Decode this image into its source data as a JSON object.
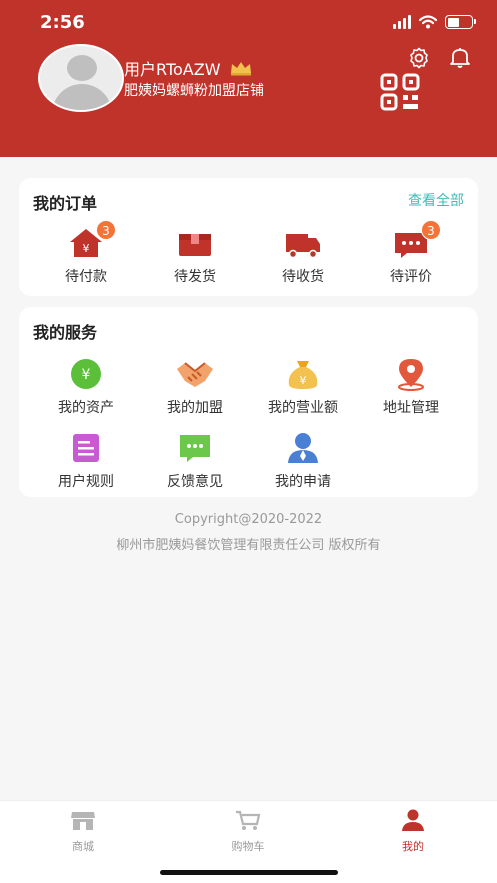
{
  "status_bar": {
    "time": "2:56"
  },
  "profile": {
    "username": "用户RToAZW",
    "store_name": "肥姨妈螺蛳粉加盟店铺"
  },
  "orders": {
    "title": "我的订单",
    "view_all": "查看全部",
    "items": [
      {
        "label": "待付款",
        "badge": "3",
        "icon": "pending-payment-icon",
        "color": "#c0332a"
      },
      {
        "label": "待发货",
        "badge": "",
        "icon": "pending-shipment-icon",
        "color": "#c0332a"
      },
      {
        "label": "待收货",
        "badge": "",
        "icon": "pending-receipt-icon",
        "color": "#c0332a"
      },
      {
        "label": "待评价",
        "badge": "3",
        "icon": "pending-review-icon",
        "color": "#c0332a"
      }
    ]
  },
  "services": {
    "title": "我的服务",
    "items": [
      {
        "label": "我的资产",
        "icon": "assets-icon",
        "color": "#5cbf3a"
      },
      {
        "label": "我的加盟",
        "icon": "handshake-icon",
        "color": "#e98a55"
      },
      {
        "label": "我的营业额",
        "icon": "money-bag-icon",
        "color": "#f2b632"
      },
      {
        "label": "地址管理",
        "icon": "location-pin-icon",
        "color": "#e2583d"
      },
      {
        "label": "用户规则",
        "icon": "rules-doc-icon",
        "color": "#c75bd1"
      },
      {
        "label": "反馈意见",
        "icon": "feedback-chat-icon",
        "color": "#6cc84a"
      },
      {
        "label": "我的申请",
        "icon": "applicant-user-icon",
        "color": "#4a7fd6"
      }
    ]
  },
  "footer": {
    "copyright": "Copyright@2020-2022",
    "company": "柳州市肥姨妈餐饮管理有限责任公司 版权所有"
  },
  "tabbar": {
    "tabs": [
      {
        "label": "商城",
        "icon": "store-icon",
        "active": false
      },
      {
        "label": "购物车",
        "icon": "cart-icon",
        "active": false
      },
      {
        "label": "我的",
        "icon": "profile-icon",
        "active": true
      }
    ]
  },
  "colors": {
    "brand": "#c0332a",
    "accent": "#3fbcb8",
    "badge": "#f37338"
  }
}
